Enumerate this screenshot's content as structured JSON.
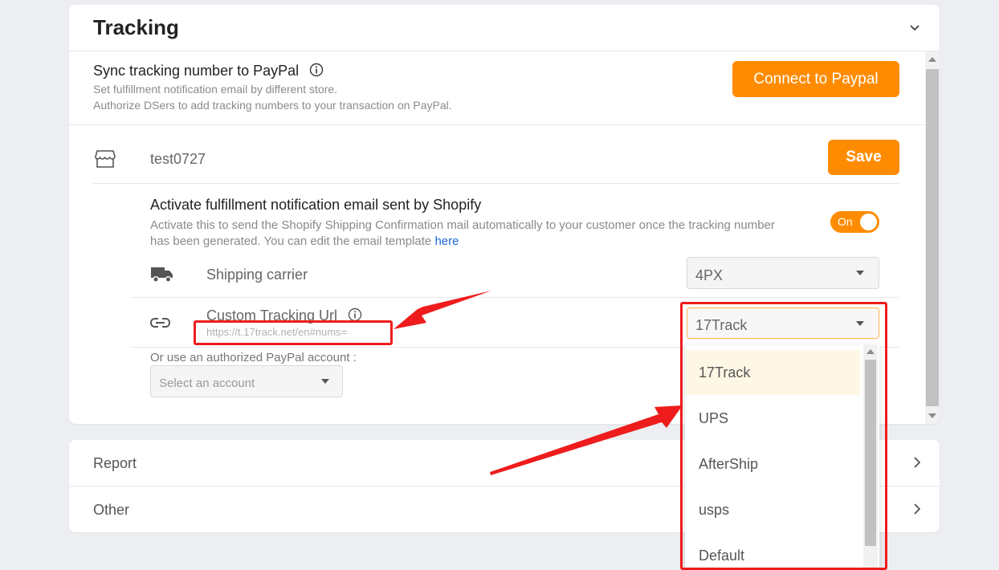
{
  "tracking": {
    "title": "Tracking",
    "sync_title": "Sync tracking number to PayPal",
    "sync_desc_1": "Set fulfillment notification email by different store.",
    "sync_desc_2": "Authorize DSers to add tracking numbers to your transaction on PayPal.",
    "connect_button": "Connect to Paypal",
    "store_name": "test0727",
    "save_button": "Save",
    "activate_title": "Activate fulfillment notification email sent by Shopify",
    "activate_desc_1": "Activate this to send the Shopify Shipping Confirmation mail automatically to your customer once the tracking number",
    "activate_desc_2": "has been generated. You can edit the email template ",
    "activate_link": "here",
    "toggle_label": "On",
    "shipping_carrier_label": "Shipping carrier",
    "shipping_carrier_value": "4PX",
    "custom_url_label": "Custom Tracking Url",
    "custom_url_value": "https://t.17track.net/en#nums=",
    "tracking_select_value": "17Track",
    "authorized_label": "Or use an authorized PayPal account :",
    "account_placeholder": "Select an account"
  },
  "dropdown_options": [
    "17Track",
    "UPS",
    "AfterShip",
    "usps",
    "Default"
  ],
  "sections": {
    "report": "Report",
    "other": "Other"
  },
  "colors": {
    "accent": "#ff8c00",
    "annotation": "#ee1c1c",
    "link": "#1a66d6",
    "selected_option_bg": "#fff7e6"
  }
}
